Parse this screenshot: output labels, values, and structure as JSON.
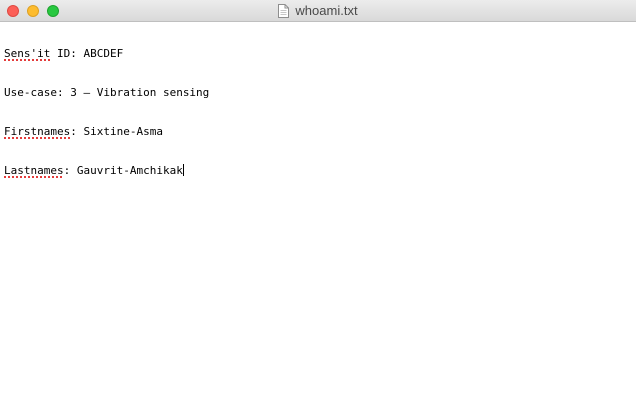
{
  "window": {
    "title": "whoami.txt",
    "buttons": {
      "close": "close",
      "minimize": "minimize",
      "zoom": "zoom"
    },
    "title_icon": "document-icon"
  },
  "document": {
    "lines": [
      {
        "key": "Sens'it",
        "rest": " ID: ABCDEF"
      },
      {
        "key": "Use-case",
        "rest": ": 3 – Vibration sensing"
      },
      {
        "key": "Firstnames",
        "rest": ": Sixtine-Asma"
      },
      {
        "key": "Lastnames",
        "rest": ": Gauvrit-Amchikak"
      }
    ]
  },
  "colors": {
    "close": "#fc5f57",
    "minimize": "#fdbc2e",
    "zoom": "#28c840",
    "spellcheck": "#e33b3b"
  }
}
